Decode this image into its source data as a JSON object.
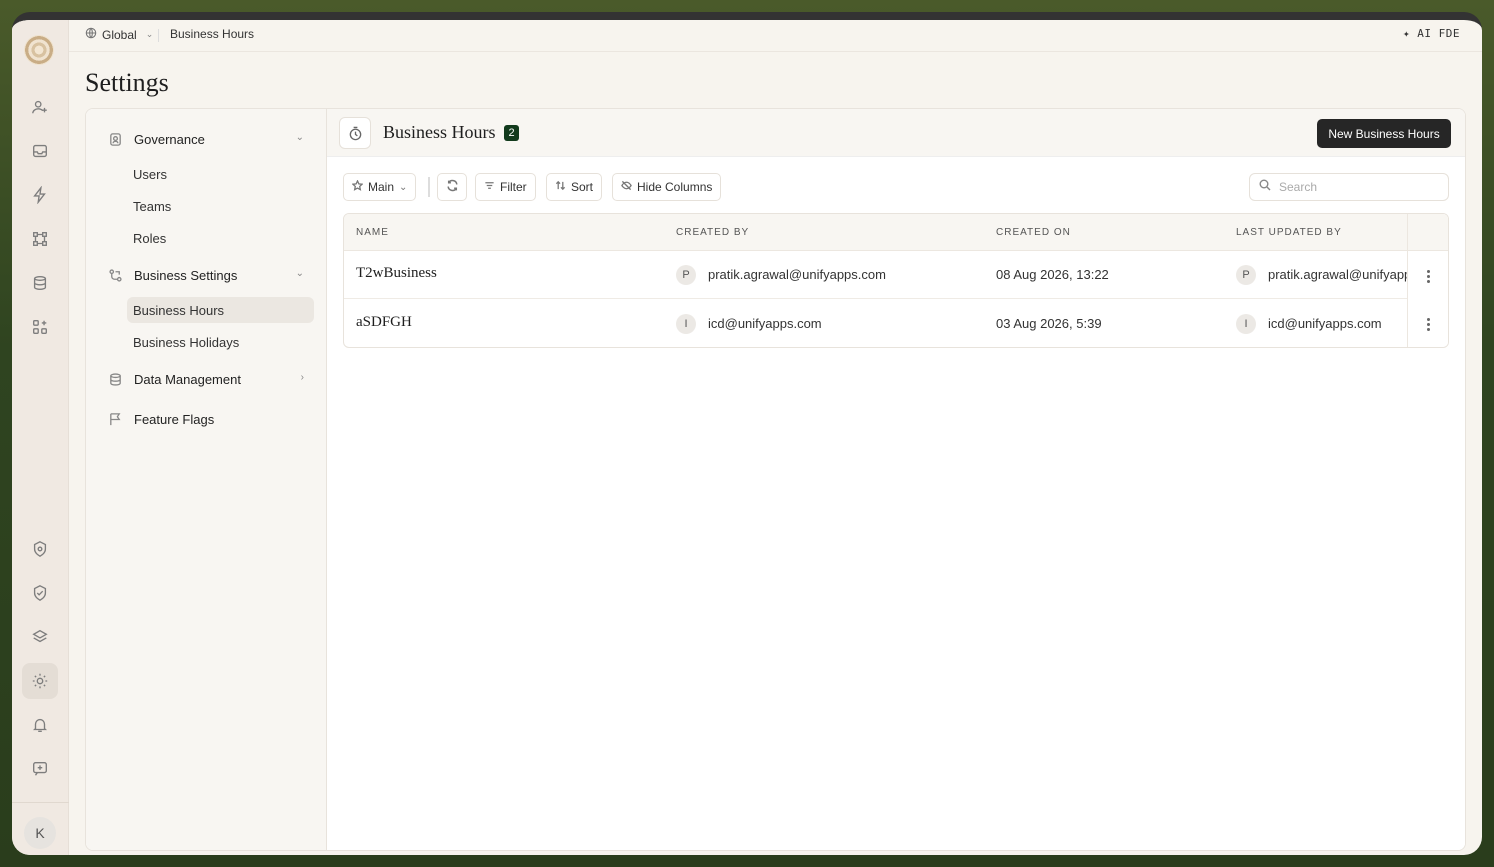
{
  "topbar": {
    "scope": "Global",
    "breadcrumb": "Business Hours",
    "ai_label": "✦ AI FDE"
  },
  "page": {
    "title": "Settings"
  },
  "rail": {
    "icons": [
      "user-plus-icon",
      "inbox-icon",
      "bolt-icon",
      "workflow-icon",
      "database-icon",
      "apps-icon",
      "shield-badge-icon",
      "shield-check-icon",
      "layers-icon",
      "settings-icon",
      "bell-icon",
      "feedback-icon"
    ],
    "user_initial": "K",
    "active": "settings-icon"
  },
  "settings_nav": {
    "governance": {
      "label": "Governance",
      "items": [
        "Users",
        "Teams",
        "Roles"
      ]
    },
    "business_settings": {
      "label": "Business Settings",
      "items": [
        "Business Hours",
        "Business Holidays"
      ],
      "active": "Business Hours"
    },
    "data_management": {
      "label": "Data Management"
    },
    "feature_flags": {
      "label": "Feature Flags"
    }
  },
  "content": {
    "title": "Business Hours",
    "count": "2",
    "new_button": "New Business Hours",
    "toolbar": {
      "view": "Main",
      "filter": "Filter",
      "sort": "Sort",
      "hide_columns": "Hide Columns",
      "search_placeholder": "Search"
    },
    "table": {
      "headers": [
        "NAME",
        "CREATED BY",
        "CREATED ON",
        "LAST UPDATED BY"
      ],
      "rows": [
        {
          "name": "T2wBusiness",
          "created_by_initial": "P",
          "created_by": "pratik.agrawal@unifyapps.com",
          "created_on": "08 Aug 2026, 13:22",
          "updated_by_initial": "P",
          "updated_by": "pratik.agrawal@unifyapp"
        },
        {
          "name": "aSDFGH",
          "created_by_initial": "I",
          "created_by": "icd@unifyapps.com",
          "created_on": "03 Aug 2026, 5:39",
          "updated_by_initial": "I",
          "updated_by": "icd@unifyapps.com"
        }
      ]
    }
  }
}
